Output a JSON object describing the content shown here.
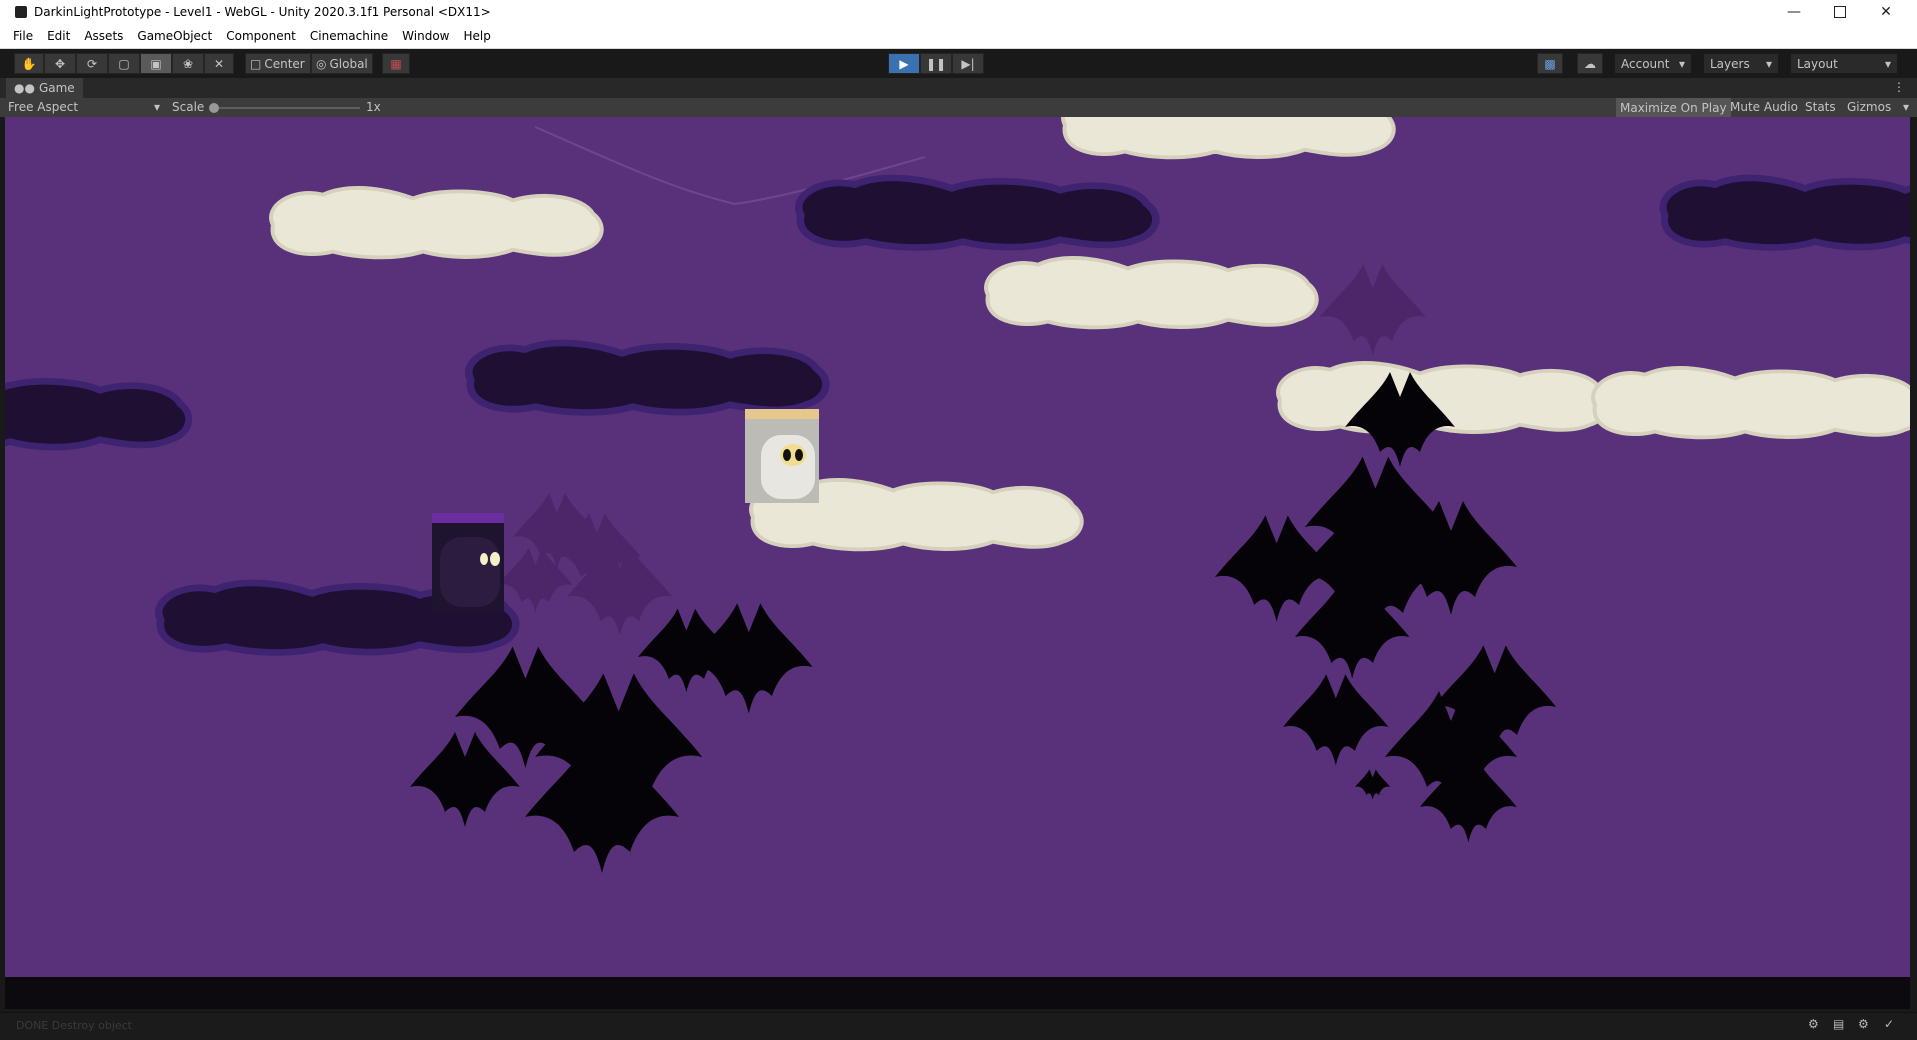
{
  "window": {
    "title": "DarkinLightPrototype - Level1 - WebGL - Unity 2020.3.1f1 Personal <DX11>",
    "minimize_icon": "minimize-icon",
    "maximize_icon": "maximize-icon",
    "close_icon": "close-icon"
  },
  "menu": {
    "items": [
      "File",
      "Edit",
      "Assets",
      "GameObject",
      "Component",
      "Cinemachine",
      "Window",
      "Help"
    ]
  },
  "toolbar": {
    "tools": [
      "hand-tool-icon",
      "move-tool-icon",
      "rotate-tool-icon",
      "scale-tool-icon",
      "rect-tool-icon",
      "transform-tool-icon",
      "custom-tool-icon"
    ],
    "active_tool": "rect-tool-icon",
    "pivot_label": "Center",
    "space_label": "Global",
    "play_icon": "play-icon",
    "pause_icon": "pause-icon",
    "step_icon": "step-icon",
    "account_label": "Account",
    "layers_label": "Layers",
    "layout_label": "Layout",
    "accent_color": "#3a72b0"
  },
  "game_view": {
    "tab_label": "Game",
    "aspect_label": "Free Aspect",
    "scale_label": "Scale",
    "scale_value": "1x",
    "maximize_label": "Maximize On Play",
    "mute_label": "Mute Audio",
    "stats_label": "Stats",
    "gizmos_label": "Gizmos",
    "background_color": "#58317a"
  },
  "status": {
    "message": "DONE Destroy object"
  }
}
